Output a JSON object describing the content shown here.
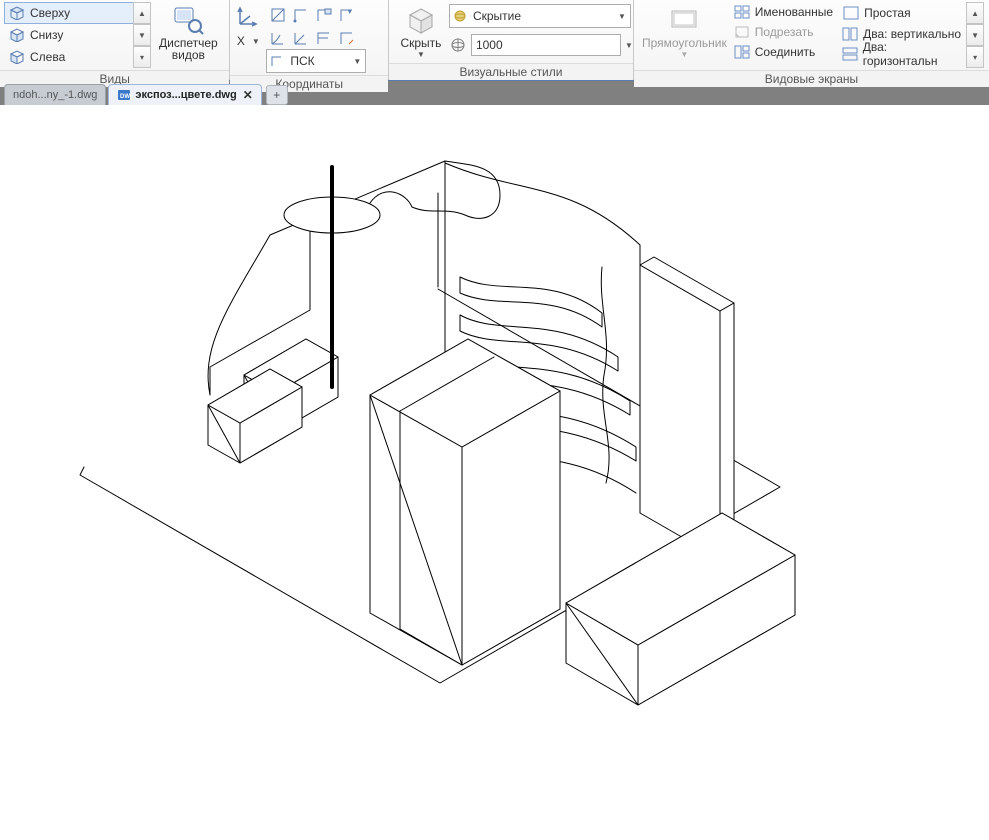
{
  "panels": {
    "views": {
      "label": "Виды",
      "items": [
        "Сверху",
        "Снизу",
        "Слева"
      ],
      "active_index": 0,
      "manager_line1": "Диспетчер",
      "manager_line2": "видов"
    },
    "coords": {
      "label": "Координаты",
      "x_btn": "X",
      "ucs_combo": "ПСК"
    },
    "visual": {
      "label": "Визуальные стили",
      "hide_btn": "Скрыть",
      "style_combo": "Скрытие",
      "scale_value": "1000"
    },
    "viewports": {
      "label": "Видовые экраны",
      "rect_btn": "Прямоугольник",
      "col2": [
        "Именованные",
        "Подрезать",
        "Соединить"
      ],
      "col3": [
        "Простая",
        "Два:   вертикально",
        "Два:   горизонтальн"
      ]
    }
  },
  "tabs": {
    "inactive_name": "ndoh...ny_-1.dwg",
    "active_name": "экспоз...цвете.dwg"
  }
}
